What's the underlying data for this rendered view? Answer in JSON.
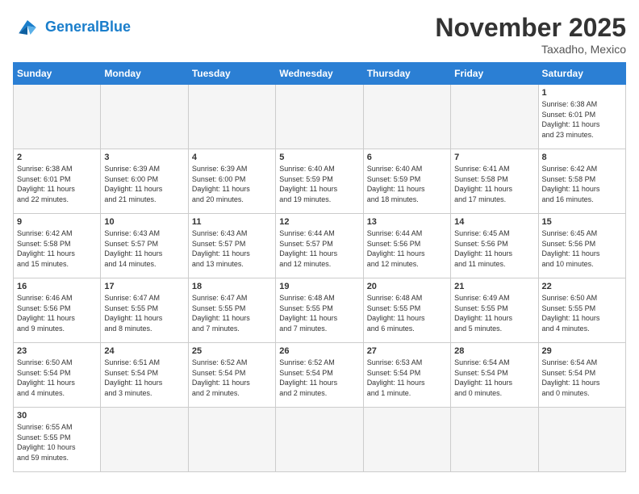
{
  "header": {
    "logo_general": "General",
    "logo_blue": "Blue",
    "month_title": "November 2025",
    "location": "Taxadho, Mexico"
  },
  "days_of_week": [
    "Sunday",
    "Monday",
    "Tuesday",
    "Wednesday",
    "Thursday",
    "Friday",
    "Saturday"
  ],
  "weeks": [
    [
      {
        "day": "",
        "content": ""
      },
      {
        "day": "",
        "content": ""
      },
      {
        "day": "",
        "content": ""
      },
      {
        "day": "",
        "content": ""
      },
      {
        "day": "",
        "content": ""
      },
      {
        "day": "",
        "content": ""
      },
      {
        "day": "1",
        "content": "Sunrise: 6:38 AM\nSunset: 6:01 PM\nDaylight: 11 hours\nand 23 minutes."
      }
    ],
    [
      {
        "day": "2",
        "content": "Sunrise: 6:38 AM\nSunset: 6:01 PM\nDaylight: 11 hours\nand 22 minutes."
      },
      {
        "day": "3",
        "content": "Sunrise: 6:39 AM\nSunset: 6:00 PM\nDaylight: 11 hours\nand 21 minutes."
      },
      {
        "day": "4",
        "content": "Sunrise: 6:39 AM\nSunset: 6:00 PM\nDaylight: 11 hours\nand 20 minutes."
      },
      {
        "day": "5",
        "content": "Sunrise: 6:40 AM\nSunset: 5:59 PM\nDaylight: 11 hours\nand 19 minutes."
      },
      {
        "day": "6",
        "content": "Sunrise: 6:40 AM\nSunset: 5:59 PM\nDaylight: 11 hours\nand 18 minutes."
      },
      {
        "day": "7",
        "content": "Sunrise: 6:41 AM\nSunset: 5:58 PM\nDaylight: 11 hours\nand 17 minutes."
      },
      {
        "day": "8",
        "content": "Sunrise: 6:42 AM\nSunset: 5:58 PM\nDaylight: 11 hours\nand 16 minutes."
      }
    ],
    [
      {
        "day": "9",
        "content": "Sunrise: 6:42 AM\nSunset: 5:58 PM\nDaylight: 11 hours\nand 15 minutes."
      },
      {
        "day": "10",
        "content": "Sunrise: 6:43 AM\nSunset: 5:57 PM\nDaylight: 11 hours\nand 14 minutes."
      },
      {
        "day": "11",
        "content": "Sunrise: 6:43 AM\nSunset: 5:57 PM\nDaylight: 11 hours\nand 13 minutes."
      },
      {
        "day": "12",
        "content": "Sunrise: 6:44 AM\nSunset: 5:57 PM\nDaylight: 11 hours\nand 12 minutes."
      },
      {
        "day": "13",
        "content": "Sunrise: 6:44 AM\nSunset: 5:56 PM\nDaylight: 11 hours\nand 12 minutes."
      },
      {
        "day": "14",
        "content": "Sunrise: 6:45 AM\nSunset: 5:56 PM\nDaylight: 11 hours\nand 11 minutes."
      },
      {
        "day": "15",
        "content": "Sunrise: 6:45 AM\nSunset: 5:56 PM\nDaylight: 11 hours\nand 10 minutes."
      }
    ],
    [
      {
        "day": "16",
        "content": "Sunrise: 6:46 AM\nSunset: 5:56 PM\nDaylight: 11 hours\nand 9 minutes."
      },
      {
        "day": "17",
        "content": "Sunrise: 6:47 AM\nSunset: 5:55 PM\nDaylight: 11 hours\nand 8 minutes."
      },
      {
        "day": "18",
        "content": "Sunrise: 6:47 AM\nSunset: 5:55 PM\nDaylight: 11 hours\nand 7 minutes."
      },
      {
        "day": "19",
        "content": "Sunrise: 6:48 AM\nSunset: 5:55 PM\nDaylight: 11 hours\nand 7 minutes."
      },
      {
        "day": "20",
        "content": "Sunrise: 6:48 AM\nSunset: 5:55 PM\nDaylight: 11 hours\nand 6 minutes."
      },
      {
        "day": "21",
        "content": "Sunrise: 6:49 AM\nSunset: 5:55 PM\nDaylight: 11 hours\nand 5 minutes."
      },
      {
        "day": "22",
        "content": "Sunrise: 6:50 AM\nSunset: 5:55 PM\nDaylight: 11 hours\nand 4 minutes."
      }
    ],
    [
      {
        "day": "23",
        "content": "Sunrise: 6:50 AM\nSunset: 5:54 PM\nDaylight: 11 hours\nand 4 minutes."
      },
      {
        "day": "24",
        "content": "Sunrise: 6:51 AM\nSunset: 5:54 PM\nDaylight: 11 hours\nand 3 minutes."
      },
      {
        "day": "25",
        "content": "Sunrise: 6:52 AM\nSunset: 5:54 PM\nDaylight: 11 hours\nand 2 minutes."
      },
      {
        "day": "26",
        "content": "Sunrise: 6:52 AM\nSunset: 5:54 PM\nDaylight: 11 hours\nand 2 minutes."
      },
      {
        "day": "27",
        "content": "Sunrise: 6:53 AM\nSunset: 5:54 PM\nDaylight: 11 hours\nand 1 minute."
      },
      {
        "day": "28",
        "content": "Sunrise: 6:54 AM\nSunset: 5:54 PM\nDaylight: 11 hours\nand 0 minutes."
      },
      {
        "day": "29",
        "content": "Sunrise: 6:54 AM\nSunset: 5:54 PM\nDaylight: 11 hours\nand 0 minutes."
      }
    ],
    [
      {
        "day": "30",
        "content": "Sunrise: 6:55 AM\nSunset: 5:55 PM\nDaylight: 10 hours\nand 59 minutes."
      },
      {
        "day": "",
        "content": ""
      },
      {
        "day": "",
        "content": ""
      },
      {
        "day": "",
        "content": ""
      },
      {
        "day": "",
        "content": ""
      },
      {
        "day": "",
        "content": ""
      },
      {
        "day": "",
        "content": ""
      }
    ]
  ]
}
